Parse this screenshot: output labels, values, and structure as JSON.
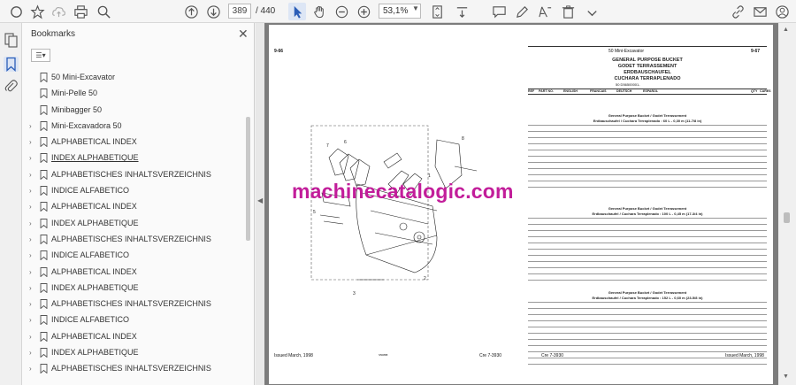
{
  "toolbar": {
    "page_current": "389",
    "page_total": "/ 440",
    "zoom": "53,1%"
  },
  "panel": {
    "title": "Bookmarks",
    "items": [
      {
        "label": "50 Mini-Excavator",
        "expandable": false
      },
      {
        "label": "Mini-Pelle 50",
        "expandable": false
      },
      {
        "label": "Minibagger 50",
        "expandable": false
      },
      {
        "label": "Mini-Excavadora 50",
        "expandable": true
      },
      {
        "label": "ALPHABETICAL INDEX",
        "expandable": true
      },
      {
        "label": "INDEX ALPHABETIQUE",
        "expandable": true
      },
      {
        "label": "ALPHABETISCHES INHALTSVERZEICHNIS",
        "expandable": true
      },
      {
        "label": "INDICE ALFABETICO",
        "expandable": true
      },
      {
        "label": "ALPHABETICAL INDEX",
        "expandable": true
      },
      {
        "label": "INDEX ALPHABETIQUE",
        "expandable": true
      },
      {
        "label": "ALPHABETISCHES INHALTSVERZEICHNIS",
        "expandable": true
      },
      {
        "label": "INDICE ALFABETICO",
        "expandable": true
      },
      {
        "label": "ALPHABETICAL INDEX",
        "expandable": true
      },
      {
        "label": "INDEX ALPHABETIQUE",
        "expandable": true
      },
      {
        "label": "ALPHABETISCHES INHALTSVERZEICHNIS",
        "expandable": true
      },
      {
        "label": "INDICE ALFABETICO",
        "expandable": true
      },
      {
        "label": "ALPHABETICAL INDEX",
        "expandable": true
      },
      {
        "label": "INDEX ALPHABETIQUE",
        "expandable": true
      },
      {
        "label": "ALPHABETISCHES INHALTSVERZEICHNIS",
        "expandable": true
      }
    ]
  },
  "document": {
    "left_page_num": "9-66",
    "right_page_num": "9-67",
    "model": "50 Mini-Excavator",
    "heading_en": "GENERAL PURPOSE BUCKET",
    "heading_fr": "GODET TERRASSEMENT",
    "heading_de": "ERDBAUSCHAUFEL",
    "heading_es": "CUCHARA TERRAPLENADO",
    "serial": "50 D56500001-",
    "columns": [
      "REF",
      "PART NO.",
      "ENGLISH",
      "FRANCAIS",
      "DEUTSCH",
      "ESPAÑOL",
      "QTY",
      "CARES"
    ],
    "footer_left": "Issued March, 1998",
    "footer_mid": "Cre 7-3930",
    "footer_mid2": "Cre 7-3930",
    "footer_right": "Issued March, 1998",
    "diagram_code": "S50888",
    "sections": [
      {
        "title1": "General Purpose Bucket / Godet Terrassement",
        "title2": "Erdbauschaufel / Cuchara Terraplenado : 60 L - 0,30 m (11-7/8 in)"
      },
      {
        "title1": "General Purpose Bucket / Godet Terrassement",
        "title2": "Erdbauschaufel / Cuchara Terraplenado : 100 L - 0,45 m (17-3/4 in)"
      },
      {
        "title1": "General Purpose Bucket / Godet Terrassement",
        "title2": "Erdbauschaufel / Cuchara Terraplenado : 152 L - 0,60 m (23-5/8 in)"
      }
    ]
  },
  "watermark": "machinecatalogic.com"
}
